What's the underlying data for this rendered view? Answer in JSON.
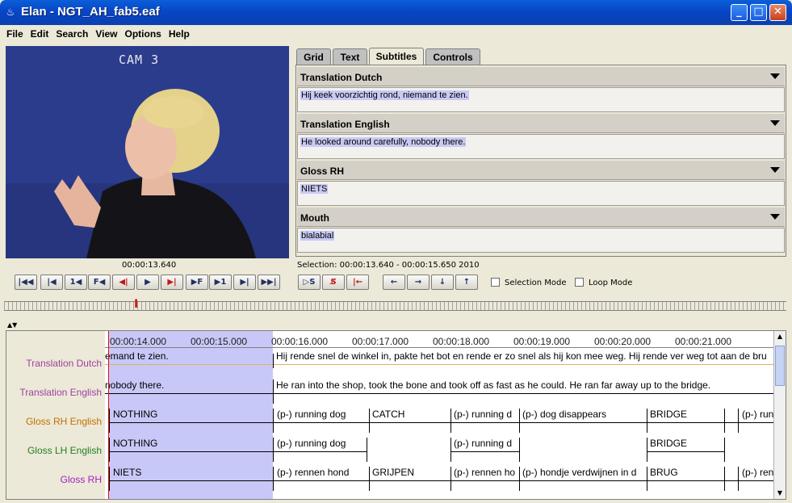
{
  "window": {
    "title": "Elan - NGT_AH_fab5.eaf"
  },
  "menu": [
    "File",
    "Edit",
    "Search",
    "View",
    "Options",
    "Help"
  ],
  "video": {
    "overlay": "CAM 3"
  },
  "tabs": [
    {
      "label": "Grid"
    },
    {
      "label": "Text"
    },
    {
      "label": "Subtitles"
    },
    {
      "label": "Controls"
    }
  ],
  "subtitles": [
    {
      "tier": "Translation Dutch",
      "value": "Hij keek voorzichtig rond, niemand te zien."
    },
    {
      "tier": "Translation English",
      "value": "He looked around carefully, nobody there."
    },
    {
      "tier": "Gloss RH",
      "value": "NIETS"
    },
    {
      "tier": "Mouth",
      "value": "bialabial"
    }
  ],
  "controls": {
    "timecode": "00:00:13.640",
    "selection": "Selection: 00:00:13.640 - 00:00:15.650  2010",
    "selection_mode": "Selection Mode",
    "loop_mode": "Loop Mode"
  },
  "timeline": {
    "ticks": [
      "00:00:14.000",
      "00:00:15.000",
      "00:00:16.000",
      "00:00:17.000",
      "00:00:18.000",
      "00:00:19.000",
      "00:00:20.000",
      "00:00:21.000"
    ],
    "tiers": [
      {
        "name": "Translation Dutch",
        "color": "#a040a0"
      },
      {
        "name": "Translation English",
        "color": "#a040a0"
      },
      {
        "name": "Gloss RH English",
        "color": "#c07000"
      },
      {
        "name": "Gloss LH English",
        "color": "#208020"
      },
      {
        "name": "Gloss RH",
        "color": "#a020c0"
      }
    ],
    "annotations": {
      "dutch": [
        "emand te zien.",
        "Hij rende snel de winkel in, pakte het bot en rende er zo snel als hij kon mee weg. Hij rende ver weg tot aan de bru"
      ],
      "english": [
        "nobody there.",
        "He ran into the shop, took the bone and took off as fast as he could. He ran far away up to the bridge."
      ],
      "gloss_rh_en": [
        "NOTHING",
        "(p-) running dog",
        "CATCH",
        "(p-) running d",
        "(p-) dog disappears",
        "BRIDGE",
        "(p-) run"
      ],
      "gloss_lh_en": [
        "NOTHING",
        "(p-) running dog",
        "(p-) running d",
        "BRIDGE"
      ],
      "gloss_rh": [
        "NIETS",
        "(p-) rennen hond",
        "GRIJPEN",
        "(p-) rennen ho",
        "(p-) hondje verdwijnen in d",
        "BRUG",
        "(p-) ren"
      ]
    }
  },
  "colors": {
    "accent": "#0a4fd0",
    "selection": "#c8c8f8",
    "cursor": "#e01010"
  }
}
